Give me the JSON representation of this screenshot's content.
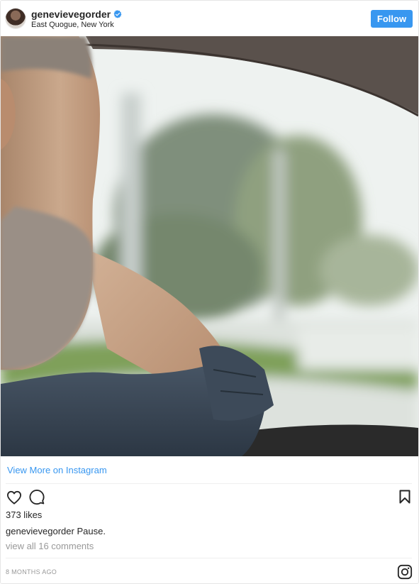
{
  "header": {
    "username": "genevievegorder",
    "location": "East Quogue, New York",
    "follow_label": "Follow",
    "verified": true
  },
  "photo": {
    "icon": "post-photo"
  },
  "view_more_label": "View More on Instagram",
  "actions": {
    "like_icon": "heart-icon",
    "comment_icon": "comment-icon",
    "save_icon": "bookmark-icon"
  },
  "likes_text": "373 likes",
  "caption": {
    "user": "genevievegorder",
    "text": "Pause."
  },
  "comments_link": "view all 16 comments",
  "timestamp": "8 MONTHS AGO",
  "footer": {
    "logo_icon": "instagram-icon"
  },
  "colors": {
    "accent": "#3897f0",
    "text": "#262626",
    "muted": "#999999",
    "divider": "#efefef"
  }
}
